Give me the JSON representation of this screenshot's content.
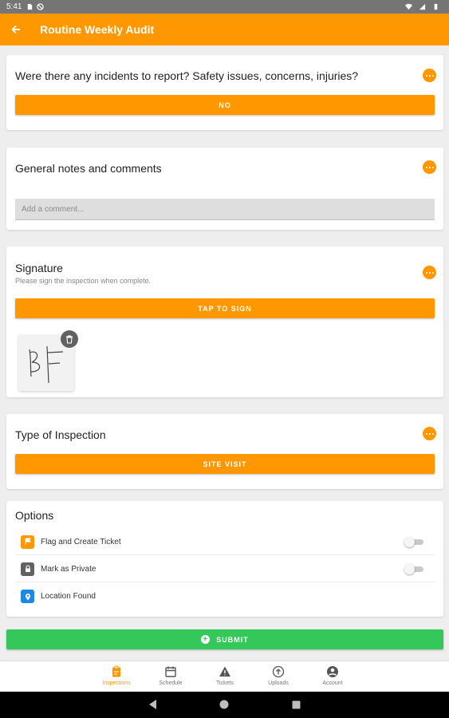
{
  "status_bar": {
    "time": "5:41"
  },
  "app_bar": {
    "title": "Routine Weekly Audit",
    "back_icon": "arrow-back-icon"
  },
  "questions": [
    {
      "title": "Were there any incidents to report? Safety issues, concerns, injuries?",
      "answer": "NO"
    },
    {
      "title": "General notes and comments",
      "comment_placeholder": "Add a comment..."
    },
    {
      "title": "Signature",
      "subtitle": "Please sign the inspection when complete.",
      "button_label": "TAP TO SIGN",
      "signature_initials": "BF"
    },
    {
      "title": "Type of Inspection",
      "answer": "SITE VISIT"
    }
  ],
  "options": {
    "title": "Options",
    "items": [
      {
        "label": "Flag and Create Ticket",
        "icon": "flag-icon",
        "color": "#ff9800",
        "toggle": false
      },
      {
        "label": "Mark as Private",
        "icon": "lock-icon",
        "color": "#616161",
        "toggle": false
      },
      {
        "label": "Location Found",
        "icon": "location-pin-icon",
        "color": "#1e88e5"
      }
    ]
  },
  "submit": {
    "label": "SUBMIT"
  },
  "bottom_nav": [
    {
      "label": "Inspections",
      "icon": "clipboard-icon",
      "active": true
    },
    {
      "label": "Schedule",
      "icon": "calendar-icon",
      "active": false
    },
    {
      "label": "Tickets",
      "icon": "warning-icon",
      "active": false
    },
    {
      "label": "Uploads",
      "icon": "upload-icon",
      "active": false
    },
    {
      "label": "Account",
      "icon": "account-icon",
      "active": false
    }
  ],
  "colors": {
    "accent": "#ff9800",
    "submit": "#34c759",
    "status_bar": "#757575"
  }
}
